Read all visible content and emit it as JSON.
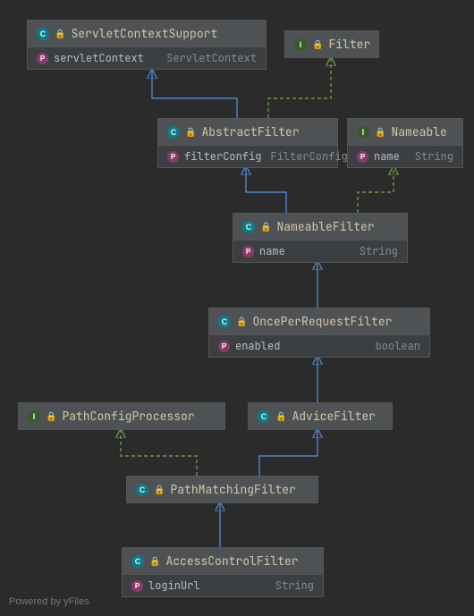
{
  "nodes": {
    "servletContextSupport": {
      "title": "ServletContextSupport",
      "prop": "servletContext",
      "ptype": "ServletContext"
    },
    "filter": {
      "title": "Filter"
    },
    "abstractFilter": {
      "title": "AbstractFilter",
      "prop": "filterConfig",
      "ptype": "FilterConfig"
    },
    "nameable": {
      "title": "Nameable",
      "prop": "name",
      "ptype": "String"
    },
    "nameableFilter": {
      "title": "NameableFilter",
      "prop": "name",
      "ptype": "String"
    },
    "oncePerRequestFilter": {
      "title": "OncePerRequestFilter",
      "prop": "enabled",
      "ptype": "boolean"
    },
    "pathConfigProcessor": {
      "title": "PathConfigProcessor"
    },
    "adviceFilter": {
      "title": "AdviceFilter"
    },
    "pathMatchingFilter": {
      "title": "PathMatchingFilter"
    },
    "accessControlFilter": {
      "title": "AccessControlFilter",
      "prop": "loginUrl",
      "ptype": "String"
    }
  },
  "footer": "Powered by yFiles"
}
